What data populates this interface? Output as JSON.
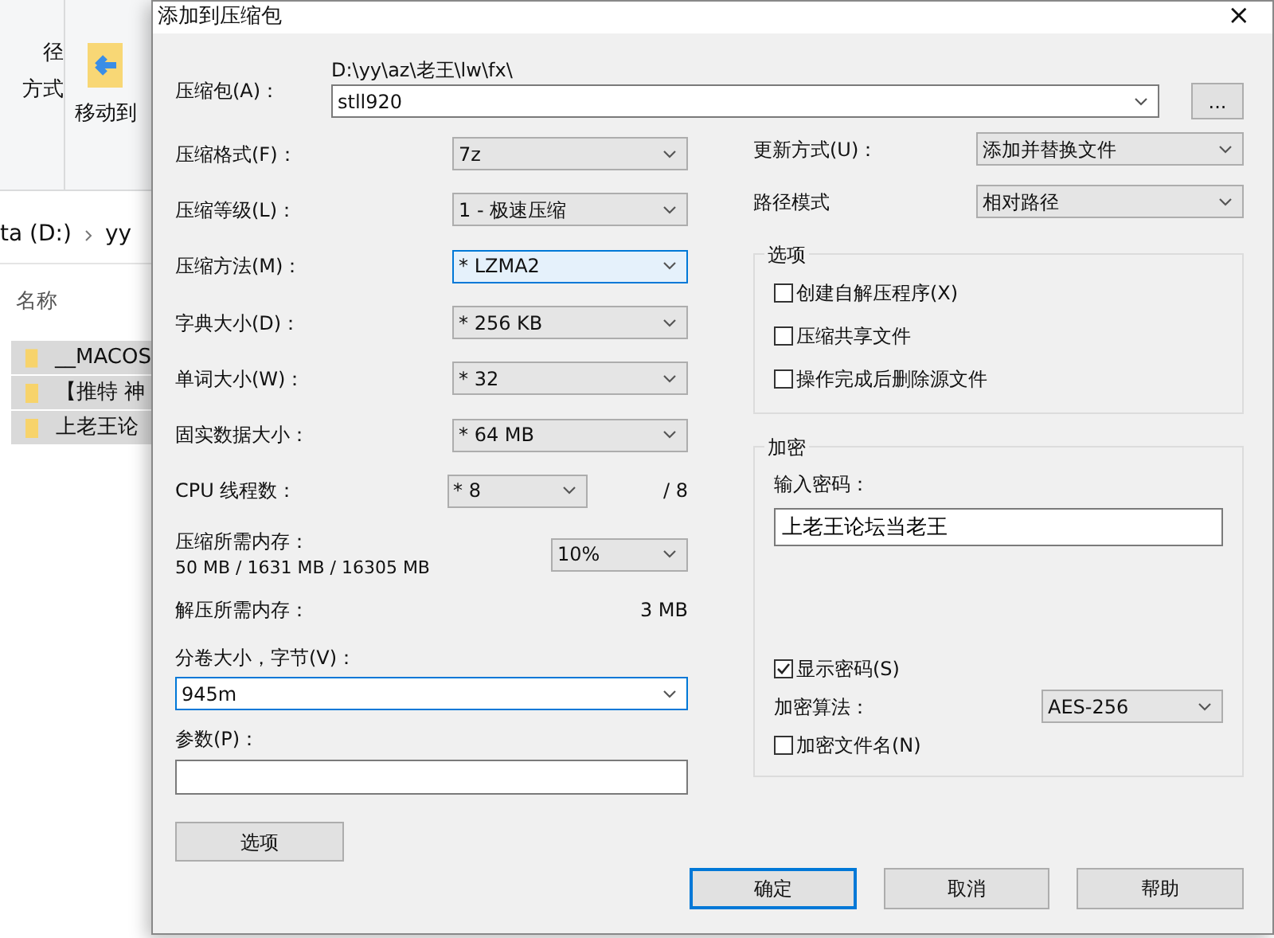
{
  "explorer": {
    "ribbon_labels": [
      "径",
      "方式"
    ],
    "move_button": "移动到",
    "breadcrumbs": [
      "ta (D:)",
      "yy"
    ],
    "column_header": "名称",
    "files": [
      {
        "name": "__MACOS",
        "selected": true
      },
      {
        "name": "【推特 神",
        "selected": true
      },
      {
        "name": "上老王论",
        "selected": true
      }
    ]
  },
  "dialog": {
    "title": "添加到压缩包",
    "close": "×",
    "archive": {
      "label": "压缩包(A)：",
      "path": "D:\\yy\\az\\老王\\lw\\fx\\",
      "value": "stll920",
      "browse": "..."
    },
    "left_fields": [
      {
        "label": "压缩格式(F)：",
        "value": "7z",
        "focused": false
      },
      {
        "label": "压缩等级(L)：",
        "value": "1 - 极速压缩",
        "focused": false
      },
      {
        "label": "压缩方法(M)：",
        "value": "* LZMA2",
        "focused": true
      },
      {
        "label": "字典大小(D)：",
        "value": "* 256 KB",
        "focused": false
      },
      {
        "label": "单词大小(W)：",
        "value": "* 32",
        "focused": false
      },
      {
        "label": "固实数据大小：",
        "value": "* 64 MB",
        "focused": false
      }
    ],
    "cpu": {
      "label": "CPU 线程数：",
      "value": "* 8",
      "max": "/ 8"
    },
    "memory": {
      "label": "压缩所需内存：",
      "usage": "50 MB / 1631 MB / 16305 MB",
      "value": "10%"
    },
    "decompress": {
      "label": "解压所需内存：",
      "value": "3 MB"
    },
    "volume": {
      "label": "分卷大小，字节(V)：",
      "value": "945m",
      "focused": true
    },
    "params": {
      "label": "参数(P)："
    },
    "options_button": "选项",
    "right_fields": [
      {
        "label": "更新方式(U)：",
        "value": "添加并替换文件"
      },
      {
        "label": "路径模式",
        "value": "相对路径"
      }
    ],
    "options_group": {
      "title": "选项",
      "items": [
        {
          "label": "创建自解压程序(X)",
          "checked": false
        },
        {
          "label": "压缩共享文件",
          "checked": false
        },
        {
          "label": "操作完成后删除源文件",
          "checked": false
        }
      ]
    },
    "encryption": {
      "title": "加密",
      "password_label": "输入密码：",
      "password": "上老王论坛当老王",
      "show_password": {
        "label": "显示密码(S)",
        "checked": true
      },
      "method_label": "加密算法：",
      "method": "AES-256",
      "encrypt_names": {
        "label": "加密文件名(N)",
        "checked": false
      }
    },
    "buttons": [
      {
        "label": "确定",
        "default": true
      },
      {
        "label": "取消",
        "default": false
      },
      {
        "label": "帮助",
        "default": false
      }
    ]
  }
}
